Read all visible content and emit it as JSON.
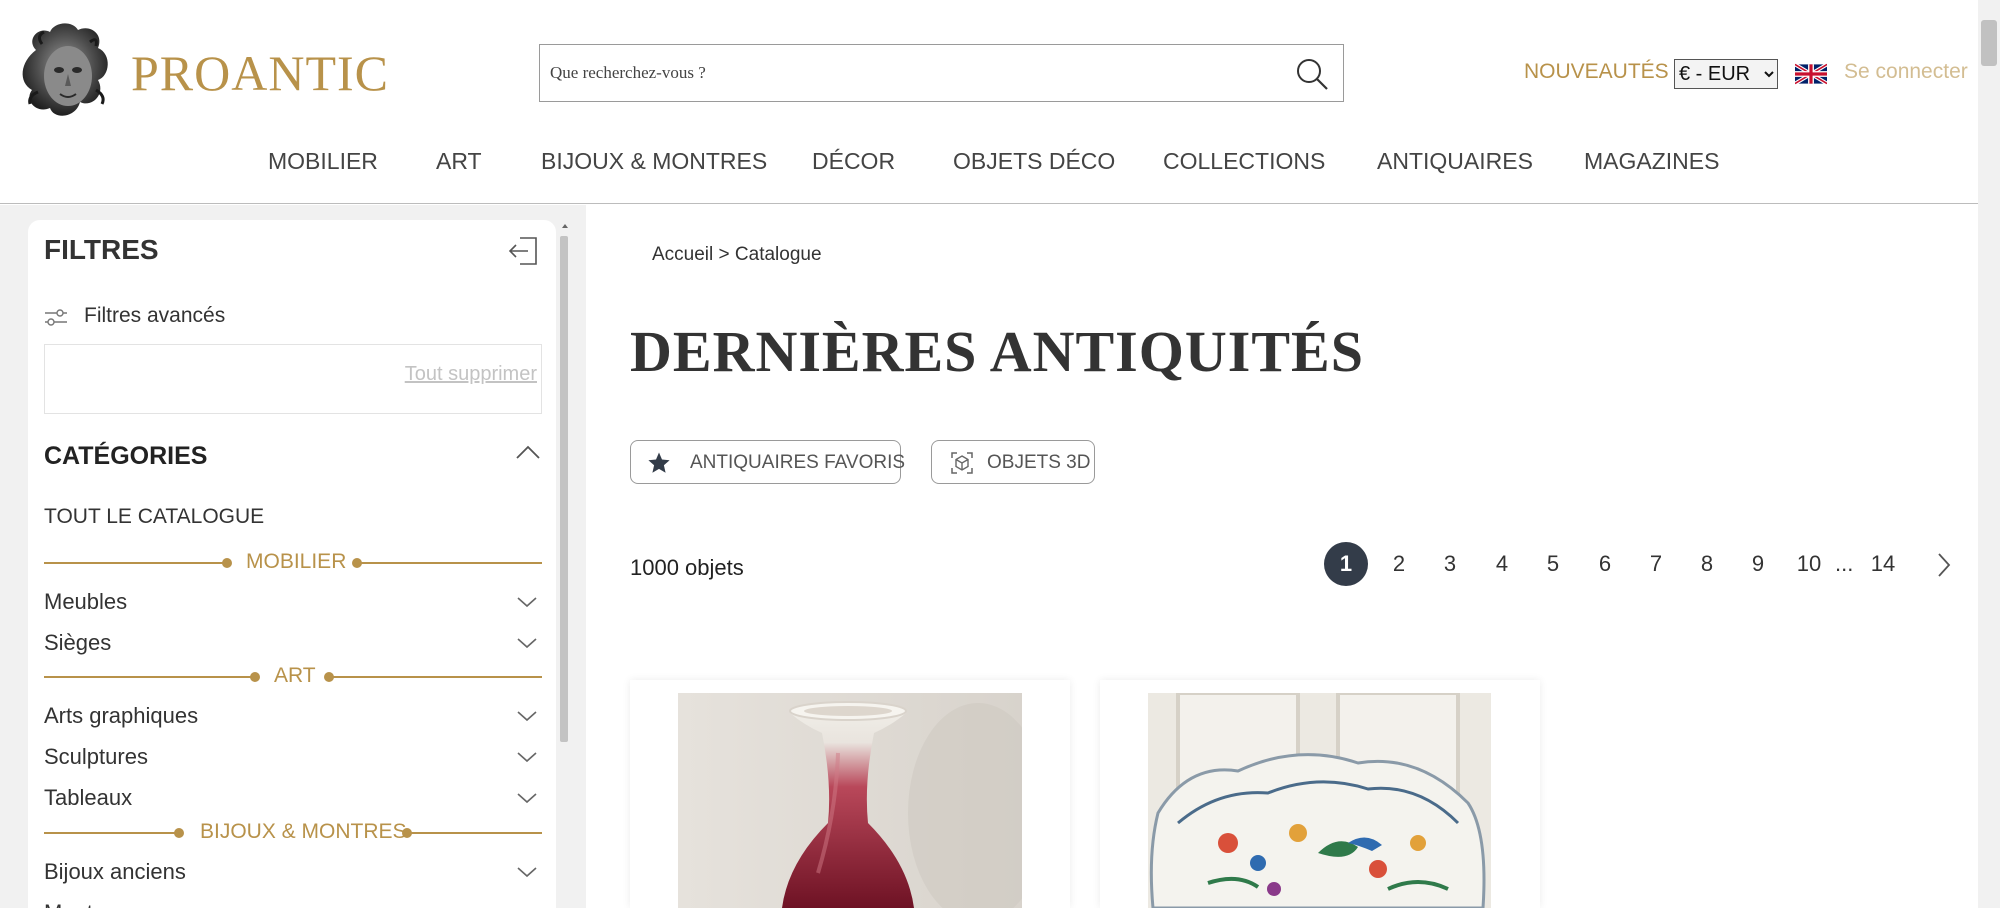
{
  "header": {
    "logo_text": "PROANTIC",
    "search_placeholder": "Que recherchez-vous ?",
    "nouveautes": "NOUVEAUTÉS",
    "currency": "€ - EUR",
    "connect": "Se connecter"
  },
  "nav": [
    "MOBILIER",
    "ART",
    "BIJOUX & MONTRES",
    "DÉCOR",
    "OBJETS DÉCO",
    "COLLECTIONS",
    "ANTIQUAIRES",
    "MAGAZINES"
  ],
  "filters": {
    "title": "FILTRES",
    "advanced": "Filtres avancés",
    "clear_all": "Tout supprimer",
    "categories_title": "CATÉGORIES",
    "all_catalogue": "TOUT LE CATALOGUE",
    "sections": [
      {
        "label": "MOBILIER",
        "items": [
          "Meubles",
          "Sièges"
        ]
      },
      {
        "label": "ART",
        "items": [
          "Arts graphiques",
          "Sculptures",
          "Tableaux"
        ]
      },
      {
        "label": "BIJOUX & MONTRES",
        "items": [
          "Bijoux anciens",
          "Montres"
        ]
      }
    ]
  },
  "breadcrumb": {
    "home": "Accueil",
    "separator": ">",
    "current": "Catalogue"
  },
  "page_title": "DERNIÈRES ANTIQUITÉS",
  "chips": {
    "favorites": "ANTIQUAIRES FAVORIS",
    "objects_3d": "OBJETS 3D"
  },
  "results": {
    "count": "1000 objets"
  },
  "pagination": {
    "pages": [
      "1",
      "2",
      "3",
      "4",
      "5",
      "6",
      "7",
      "8",
      "9",
      "10"
    ],
    "ellipsis": "...",
    "last": "14",
    "active": "1"
  },
  "colors": {
    "gold": "#b8924a",
    "pager_active": "#333c49",
    "panel_bg": "#f1f1f1"
  }
}
